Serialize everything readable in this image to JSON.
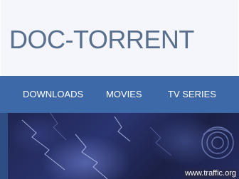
{
  "header": {
    "site_title": "DOC-TORRENT"
  },
  "nav": {
    "items": [
      {
        "label": "DOWNLOADS"
      },
      {
        "label": "MOVIES"
      },
      {
        "label": "TV SERIES"
      }
    ]
  },
  "hero": {
    "image_name": "hero-banner-image"
  },
  "watermark": {
    "text": "www.traffic.org"
  },
  "colors": {
    "title": "#58708e",
    "nav_background": "#3d69a8",
    "nav_text": "#ffffff",
    "hero_dark": "#141932"
  }
}
